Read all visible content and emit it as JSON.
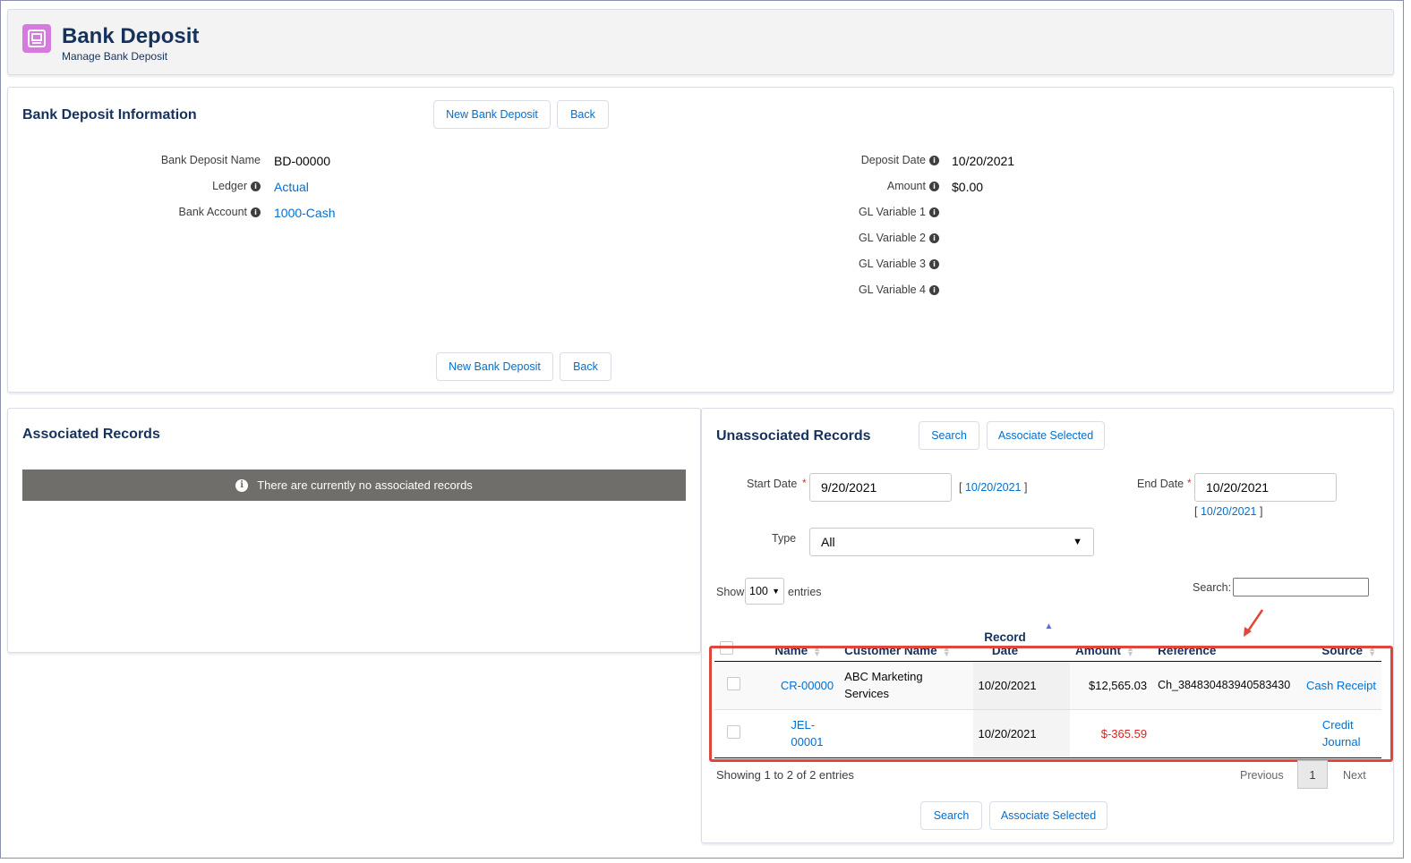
{
  "header": {
    "title": "Bank Deposit",
    "subtitle": "Manage Bank Deposit",
    "icon": "bank-deposit-icon",
    "icon_color": "#d67ae0"
  },
  "info_section": {
    "title": "Bank Deposit Information",
    "new_button": "New Bank Deposit",
    "back_button": "Back",
    "left_fields": [
      {
        "label": "Bank Deposit Name",
        "value": "BD-00000"
      },
      {
        "label": "Ledger",
        "value": "Actual"
      },
      {
        "label": "Bank Account",
        "value": "1000-Cash"
      }
    ],
    "right_fields": [
      {
        "label": "Deposit Date",
        "value": "10/20/2021"
      },
      {
        "label": "Amount",
        "value": "$0.00"
      },
      {
        "label": "GL Variable 1",
        "value": ""
      },
      {
        "label": "GL Variable 2",
        "value": ""
      },
      {
        "label": "GL Variable 3",
        "value": ""
      },
      {
        "label": "GL Variable 4",
        "value": ""
      }
    ]
  },
  "associated": {
    "title": "Associated Records",
    "empty_message": "There are currently no associated records"
  },
  "unassociated": {
    "title": "Unassociated Records",
    "search_button": "Search",
    "associate_button": "Associate Selected",
    "start_date_label": "Start Date",
    "start_date_value": "9/20/2021",
    "start_date_today": "10/20/2021",
    "end_date_label": "End Date",
    "end_date_value": "10/20/2021",
    "end_date_today": "10/20/2021",
    "type_label": "Type",
    "type_value": "All",
    "show_label": "Show",
    "entries_value": "100",
    "entries_label": "entries",
    "search_label": "Search:",
    "columns": [
      "Name",
      "Customer Name",
      "Record Date",
      "Amount",
      "Reference",
      "Source"
    ],
    "rows": [
      {
        "name": "CR-00000",
        "customer": "ABC Marketing Services",
        "date": "10/20/2021",
        "amount": "$12,565.03",
        "reference": "Ch_384830483940583430",
        "source": "Cash Receipt"
      },
      {
        "name": "JEL-00001",
        "customer": "",
        "date": "10/20/2021",
        "amount": "$-365.59",
        "reference": "",
        "source": "Credit Journal"
      }
    ],
    "showing_text": "Showing 1 to 2 of 2 entries",
    "previous": "Previous",
    "page": "1",
    "next": "Next",
    "highlight_color": "#e2453a"
  }
}
